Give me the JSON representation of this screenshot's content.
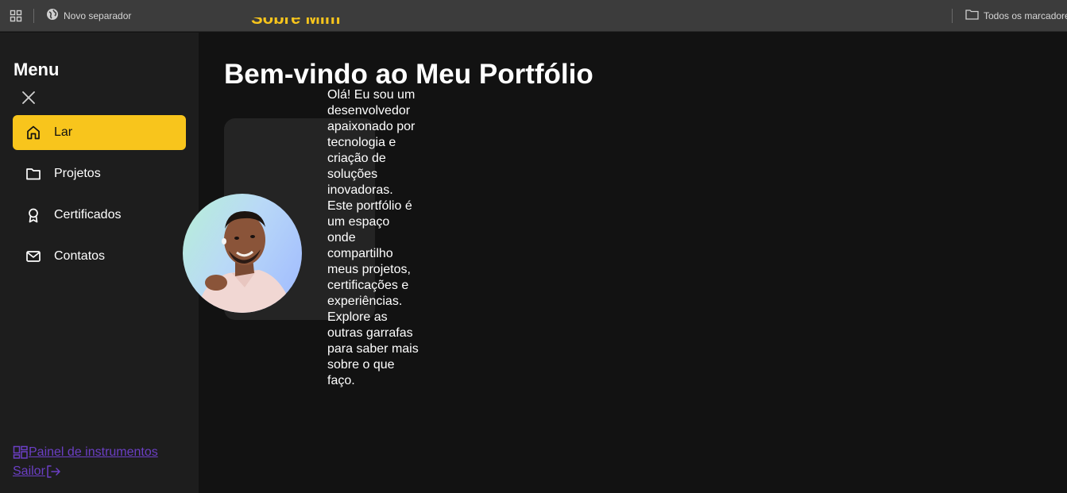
{
  "browser": {
    "new_tab_label": "Novo separador",
    "all_bookmarks_label": "Todos os marcadore"
  },
  "sidebar": {
    "title": "Menu",
    "items": [
      {
        "label": "Lar",
        "icon": "home-icon",
        "active": true
      },
      {
        "label": "Projetos",
        "icon": "folder-icon",
        "active": false
      },
      {
        "label": "Certificados",
        "icon": "award-icon",
        "active": false
      },
      {
        "label": "Contatos",
        "icon": "mail-icon",
        "active": false
      }
    ],
    "dashboard_label": "Painel de instrumentos",
    "logout_label": "Sailor"
  },
  "main": {
    "section_heading": "Sobre Mim",
    "title": "Bem-vindo ao Meu Portfólio",
    "intro": "Olá! Eu sou um desenvolvedor apaixonado por tecnologia e criação de soluções inovadoras. Este portfólio é um espaço onde compartilho meus projetos, certificações e experiências. Explore as outras garrafas para saber mais sobre o que faço."
  },
  "colors": {
    "accent": "#f8c51c",
    "sidebar_bg": "#1d1d1d",
    "page_bg": "#121212",
    "link": "#6b3fc4"
  }
}
